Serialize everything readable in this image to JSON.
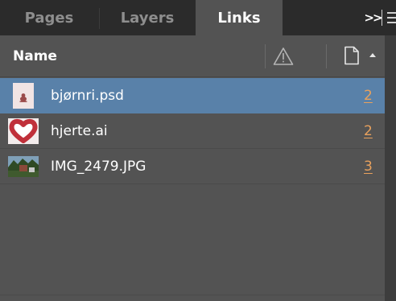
{
  "tabs": [
    {
      "label": "Pages",
      "active": false
    },
    {
      "label": "Layers",
      "active": false
    },
    {
      "label": "Links",
      "active": true
    }
  ],
  "tab_overflow": ">>",
  "header": {
    "name_label": "Name",
    "warning_icon": "warning-triangle-icon",
    "page_icon": "page-icon",
    "sort_icon": "sort-ascending-icon"
  },
  "links": [
    {
      "name": "bjørnri.psd",
      "count": "2",
      "selected": true,
      "thumb": "bear-thumbnail"
    },
    {
      "name": "hjerte.ai",
      "count": "2",
      "selected": false,
      "thumb": "heart-thumbnail"
    },
    {
      "name": "IMG_2479.JPG",
      "count": "3",
      "selected": false,
      "thumb": "photo-thumbnail"
    }
  ],
  "colors": {
    "panel_bg": "#535353",
    "tabbar_bg": "#2b2b2b",
    "selection": "#5981a9",
    "count_link": "#e8a15d",
    "heart": "#c0303a"
  }
}
